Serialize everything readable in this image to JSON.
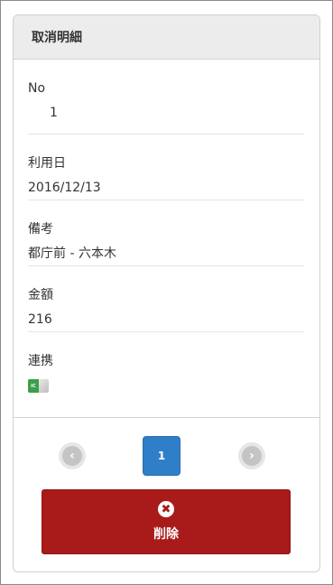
{
  "header": {
    "title": "取消明細"
  },
  "fields": {
    "no": {
      "label": "No",
      "value": "1"
    },
    "date": {
      "label": "利用日",
      "value": "2016/12/13"
    },
    "note": {
      "label": "備考",
      "value": "都庁前 - 六本木"
    },
    "amount": {
      "label": "金額",
      "value": "216"
    },
    "link": {
      "label": "連携",
      "icon": "ic-card-icon",
      "icon_text": "IC"
    }
  },
  "pager": {
    "prev_icon": "chevron-left-icon",
    "current_page": "1",
    "next_icon": "chevron-right-icon"
  },
  "actions": {
    "delete_label": "削除",
    "delete_icon": "close-icon"
  },
  "colors": {
    "header_bg": "#ececec",
    "page_active": "#2f7fc8",
    "delete_bg": "#a91b1b",
    "ic_green": "#3aa04a"
  }
}
